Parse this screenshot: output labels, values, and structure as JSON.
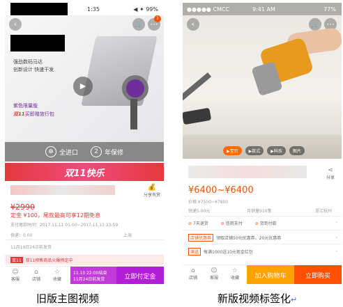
{
  "phoneA": {
    "status_time": "1:35",
    "status_right": "◀ ✦ 99%",
    "cart_badge": "1",
    "promo_line1": "强劲数码马达",
    "promo_line2": "创新设计 快速干发",
    "promo_edition": "紫色限量版",
    "promo_gift_tag": "双11",
    "promo_gift": "买即赠旅行包",
    "badge1": "全进口",
    "badge2_num": "2",
    "badge2": "年保修",
    "banner": "双11快乐",
    "share": "分享有赏",
    "price": "¥2990",
    "deposit": "定金 ¥100，尾款最高可享12期免息",
    "pay_time": "支付尾款时间：2017.11.11 01:00~2017.11.11 23:59",
    "ship_left": "快递：0.00",
    "ship_right": "上海",
    "send_date": "11月19日24点前发货",
    "pre_tag": "双11",
    "pre_text": "双11预售商品火爆预定中",
    "tabs": [
      "客服",
      "店铺",
      "收藏"
    ],
    "countdown1": "11.10 22:00结束",
    "countdown2": "11月24日前发货",
    "pay_button": "立即付定金"
  },
  "phoneB": {
    "carrier": "●●●●● CMCC",
    "time": "9:41 AM",
    "battery": "77%",
    "video_tabs": [
      "宝贝",
      "款式",
      "科技",
      "图片"
    ],
    "share": "分享",
    "price": "¥6400~¥6400",
    "orig_price": "价格 ¥7500~¥7800",
    "shipping": "快递5.00元",
    "sales": "月销量910笔",
    "location": "浙江杭州",
    "services": [
      "7天退货",
      "信用支付",
      "货到付款"
    ],
    "coupon_tag": "店铺优惠券",
    "coupon_text": "领取店铺50元优惠券，20元优惠券",
    "promo_tag": "满送",
    "promo_text": "每满1000送10元现金红包",
    "tabs": [
      "店铺",
      "客服",
      "收藏"
    ],
    "cart_button": "加入购物车",
    "buy_button": "立即购买"
  },
  "captions": {
    "left": "旧版主图视频",
    "right": "新版视频标签化"
  },
  "colors": {
    "red": "#e4393c",
    "orange": "#ff6a00",
    "purple": "#b21dd8"
  }
}
